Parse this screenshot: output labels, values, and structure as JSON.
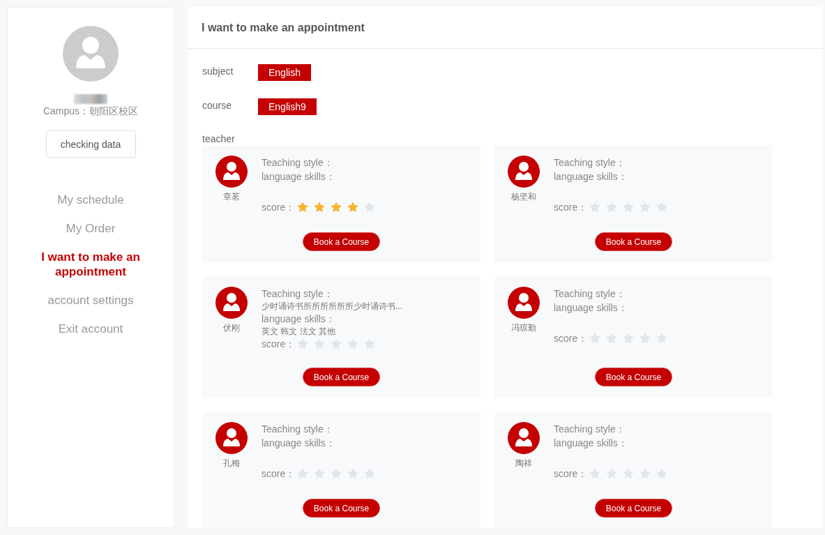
{
  "sidebar": {
    "campus": "Campus：朝阳区校区",
    "button": "checking data",
    "nav": [
      {
        "label": "My schedule",
        "selected": false
      },
      {
        "label": "My Order",
        "selected": false
      },
      {
        "label": "I want to make an appointment",
        "selected": true
      },
      {
        "label": "account settings",
        "selected": false
      },
      {
        "label": "Exit account",
        "selected": false
      }
    ]
  },
  "main": {
    "title": "I want to make an appointment",
    "fields": [
      {
        "label": "subject",
        "value": "English"
      },
      {
        "label": "course",
        "value": "English9"
      }
    ],
    "teacher_label": "teacher",
    "teachers": [
      {
        "name": "章茗",
        "style_label": "Teaching style：",
        "skills_label": "language skills：",
        "score_label": "score：",
        "stars": 4,
        "button": "Book a Course"
      },
      {
        "name": "杨坚和",
        "style_label": "Teaching style：",
        "skills_label": "language skills：",
        "score_label": "score：",
        "stars": 0,
        "button": "Book a Course"
      },
      {
        "name": "伏刚",
        "style_label": "Teaching style：",
        "style": "少时诵诗书所所所所所所少时诵诗书...",
        "skills_label": "language skills：",
        "skills": "英文 韩文 法文 其他",
        "score_label": "score：",
        "stars": 0,
        "button": "Book a Course"
      },
      {
        "name": "冯琼勤",
        "style_label": "Teaching style：",
        "skills_label": "language skills：",
        "score_label": "score：",
        "stars": 0,
        "button": "Book a Course"
      },
      {
        "name": "孔梅",
        "style_label": "Teaching style：",
        "skills_label": "language skills：",
        "score_label": "score：",
        "stars": 0,
        "button": "Book a Course"
      },
      {
        "name": "陶祥",
        "style_label": "Teaching style：",
        "skills_label": "language skills：",
        "score_label": "score：",
        "stars": 0,
        "button": "Book a Course"
      }
    ]
  }
}
